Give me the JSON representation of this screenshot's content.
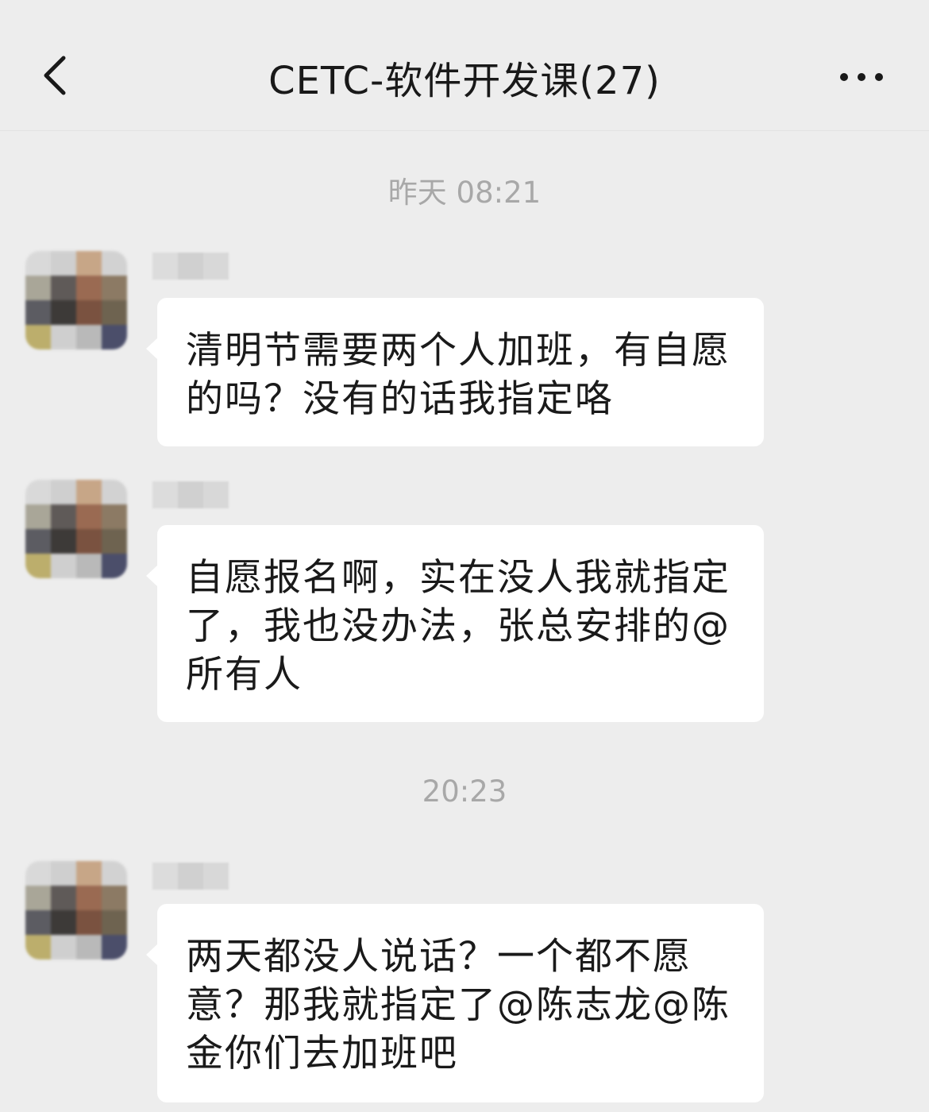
{
  "header": {
    "title": "CETC-软件开发课(27)",
    "back_icon": "chevron-left-icon",
    "more_icon": "more-horizontal-icon"
  },
  "messages": [
    {
      "type": "timestamp",
      "text": "昨天 08:21"
    },
    {
      "type": "message",
      "text": "清明节需要两个人加班，有自愿的吗？没有的话我指定咯"
    },
    {
      "type": "message",
      "text": "自愿报名啊，实在没人我就指定了，我也没办法，张总安排的@所有人"
    },
    {
      "type": "timestamp",
      "text": "20:23"
    },
    {
      "type": "message",
      "text": "两天都没人说话？一个都不愿意？那我就指定了@陈志龙@陈金你们去加班吧"
    }
  ],
  "colors": {
    "background": "#ededed",
    "bubble": "#ffffff",
    "timestamp": "#a8a8a8",
    "text": "#1a1a1a"
  }
}
